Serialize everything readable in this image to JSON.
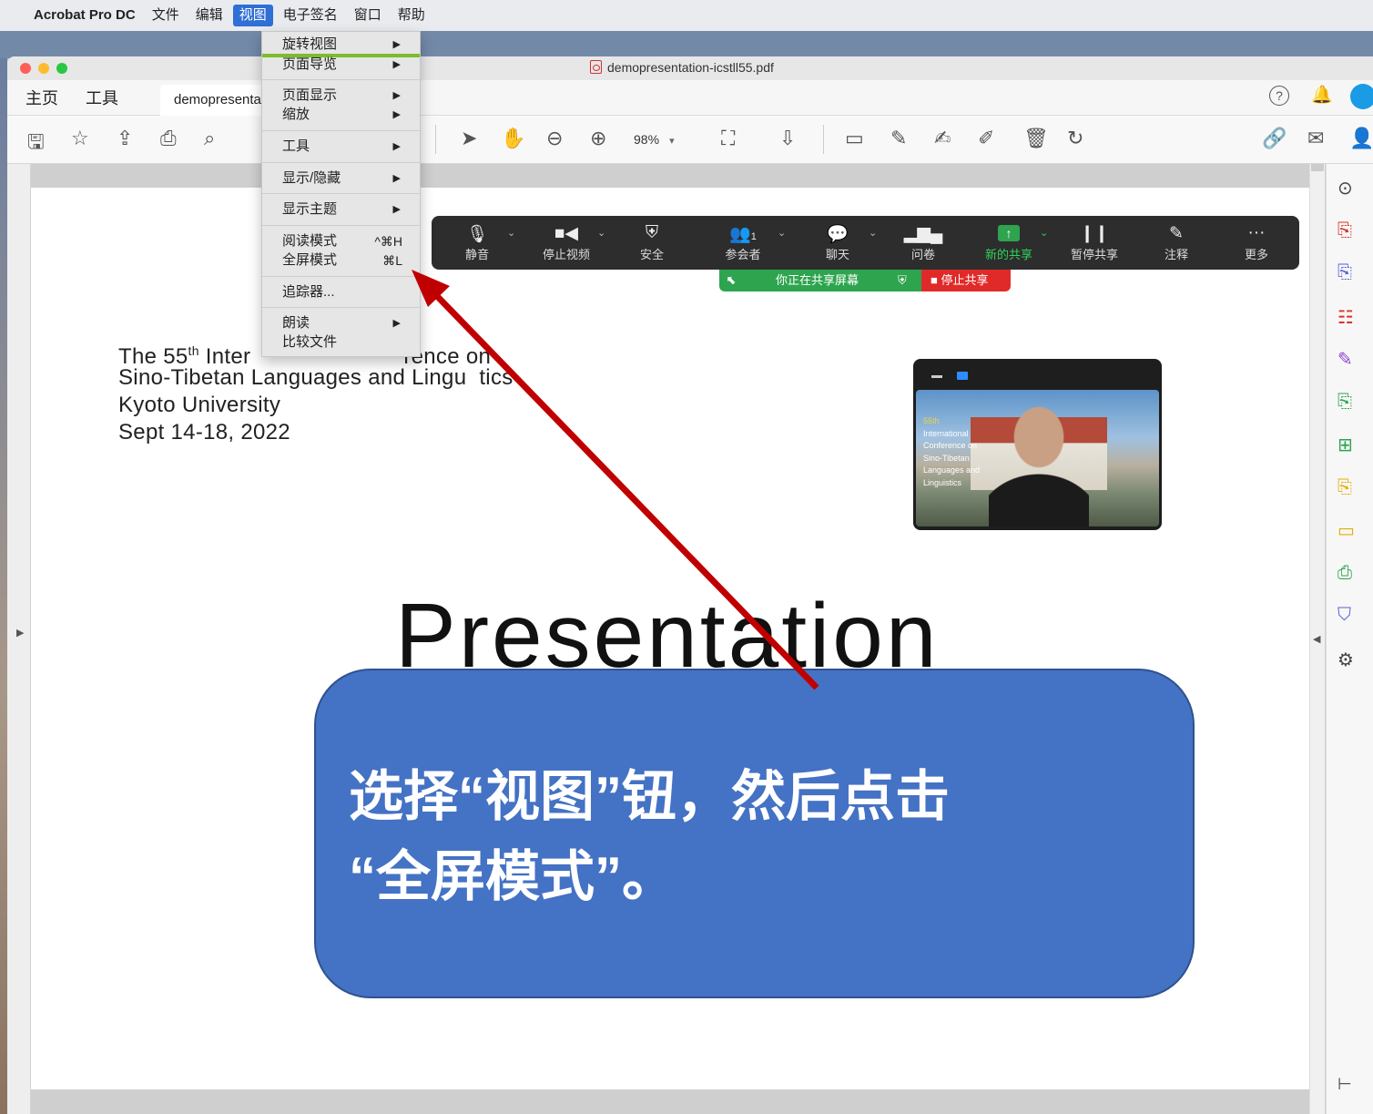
{
  "menubar": {
    "apple": "",
    "app": "Acrobat Pro DC",
    "items": [
      "文件",
      "编辑",
      "视图",
      "电子签名",
      "窗口",
      "帮助"
    ]
  },
  "window": {
    "title": "demopresentation-icstll55.pdf",
    "tabs": {
      "home": "主页",
      "tools": "工具",
      "doc": "demopresenta"
    }
  },
  "toolbar": {
    "zoom": "98%"
  },
  "view_menu": {
    "items": [
      {
        "label": "旋转视图",
        "submenu": true
      },
      {
        "label": "页面导览",
        "submenu": true
      },
      {
        "label": "页面显示",
        "submenu": true
      },
      {
        "label": "缩放",
        "submenu": true
      },
      {
        "label": "工具",
        "submenu": true
      },
      {
        "label": "显示/隐藏",
        "submenu": true
      },
      {
        "label": "显示主题",
        "submenu": true
      },
      {
        "label": "阅读模式",
        "shortcut": "^⌘H"
      },
      {
        "label": "全屏模式",
        "shortcut": "⌘L"
      },
      {
        "label": "追踪器..."
      },
      {
        "label": "朗读",
        "submenu": true
      },
      {
        "label": "比较文件"
      }
    ],
    "arrow_glyph": "▶"
  },
  "zoom_bar": {
    "buttons": [
      "静音",
      "停止视频",
      "安全",
      "参会者",
      "聊天",
      "问卷",
      "新的共享",
      "暂停共享",
      "注释",
      "更多"
    ],
    "participant_count": "1",
    "sharing_text": "你正在共享屏幕",
    "stop_share": "■ 停止共享"
  },
  "video_thumb": {
    "lines": [
      "55th",
      "International",
      "Conference on",
      "Sino-Tibetan",
      "Languages and",
      "Linguistics"
    ]
  },
  "document": {
    "conf_line1_a": "The 55",
    "conf_line1_sup": "th",
    "conf_line1_b": " Inter",
    "conf_line1_c": "rence on",
    "conf_line2_a": " Sino-Tibetan Languages and Lingu",
    "conf_line2_b": "tics",
    "conf_line3": "Kyoto University",
    "conf_line4": "Sept 14-18, 2022",
    "big_title": "Presentation"
  },
  "callout": {
    "line1": "选择“视图”钮，然后点击",
    "line2": "“全屏模式”。"
  },
  "colors": {
    "callout_bg": "#4472c4",
    "arrow": "#c00000",
    "menu_highlight": "#2f6fd6",
    "share_green": "#2ea44f",
    "stop_red": "#e02a2a"
  }
}
